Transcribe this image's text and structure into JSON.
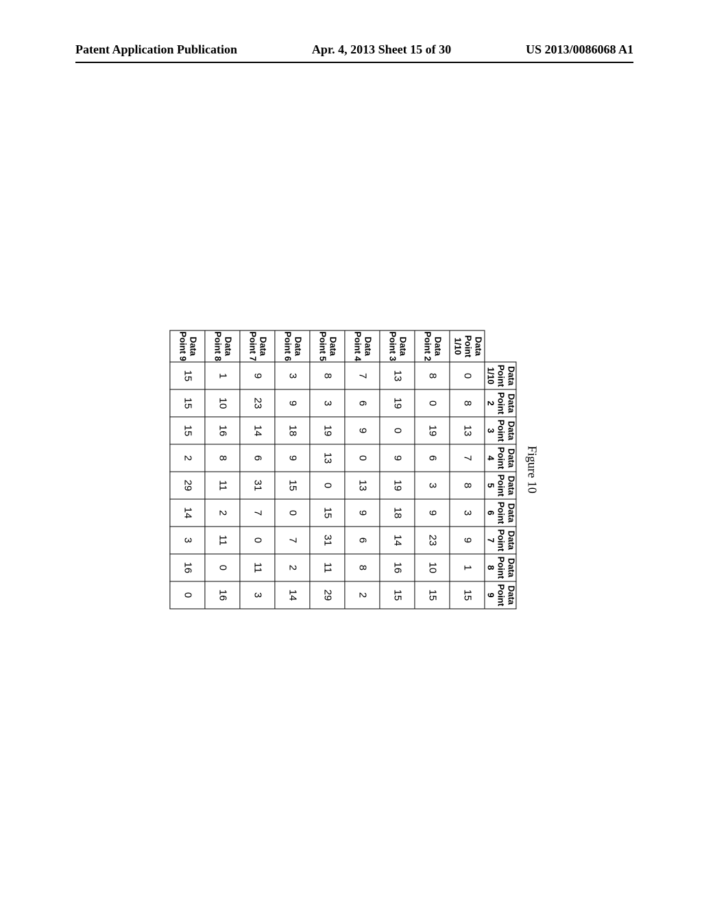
{
  "header": {
    "left": "Patent Application Publication",
    "center": "Apr. 4, 2013  Sheet 15 of 30",
    "right": "US 2013/0086068 A1"
  },
  "figure_caption": "Figure 10",
  "table": {
    "col_headers": [
      "Data Point 1/10",
      "Data Point 2",
      "Data Point 3",
      "Data Point 4",
      "Data Point 5",
      "Data Point 6",
      "Data Point 7",
      "Data Point 8",
      "Data Point 9"
    ],
    "row_headers": [
      "Data Point 1/10",
      "Data Point 2",
      "Data Point 3",
      "Data Point 4",
      "Data Point 5",
      "Data Point 6",
      "Data Point 7",
      "Data Point 8",
      "Data Point 9"
    ],
    "rows": [
      [
        "0",
        "8",
        "13",
        "7",
        "8",
        "3",
        "9",
        "1",
        "15"
      ],
      [
        "8",
        "0",
        "19",
        "6",
        "3",
        "9",
        "23",
        "10",
        "15"
      ],
      [
        "13",
        "19",
        "0",
        "9",
        "19",
        "18",
        "14",
        "16",
        "15"
      ],
      [
        "7",
        "6",
        "9",
        "0",
        "13",
        "9",
        "6",
        "8",
        "2"
      ],
      [
        "8",
        "3",
        "19",
        "13",
        "0",
        "15",
        "31",
        "11",
        "29"
      ],
      [
        "3",
        "9",
        "18",
        "9",
        "15",
        "0",
        "7",
        "2",
        "14"
      ],
      [
        "9",
        "23",
        "14",
        "6",
        "31",
        "7",
        "0",
        "11",
        "3"
      ],
      [
        "1",
        "10",
        "16",
        "8",
        "11",
        "2",
        "11",
        "0",
        "16"
      ],
      [
        "15",
        "15",
        "15",
        "2",
        "29",
        "14",
        "3",
        "16",
        "0"
      ]
    ]
  }
}
